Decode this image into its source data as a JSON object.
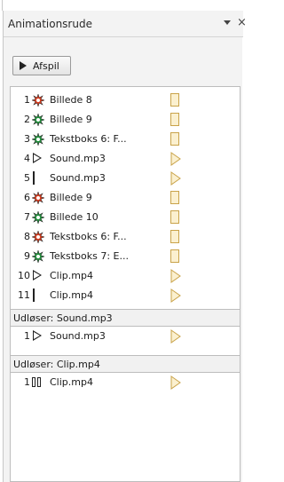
{
  "pane": {
    "title": "Animationsrude",
    "menu_icon": "chevron-down-icon",
    "close_label": "×"
  },
  "toolbar": {
    "play_label": "Afspil"
  },
  "items": [
    {
      "num": "1",
      "icon": "star-burst-red-icon",
      "color": "#e53c1c",
      "name": "Billede 8",
      "timing": "bar"
    },
    {
      "num": "2",
      "icon": "star-burst-green-icon",
      "color": "#1e9a3c",
      "name": "Billede 9",
      "timing": "bar"
    },
    {
      "num": "3",
      "icon": "star-burst-green-icon",
      "color": "#1e9a3c",
      "name": "Tekstboks 6: F...",
      "timing": "bar"
    },
    {
      "num": "4",
      "icon": "play-icon",
      "color": "#222222",
      "name": "Sound.mp3",
      "timing": "triangle"
    },
    {
      "num": "5",
      "icon": "stop-icon",
      "color": "#222222",
      "name": "Sound.mp3",
      "timing": "triangle"
    },
    {
      "num": "6",
      "icon": "star-burst-red-icon",
      "color": "#e53c1c",
      "name": "Billede 9",
      "timing": "bar"
    },
    {
      "num": "7",
      "icon": "star-burst-green-icon",
      "color": "#1e9a3c",
      "name": "Billede 10",
      "timing": "bar"
    },
    {
      "num": "8",
      "icon": "star-burst-red-icon",
      "color": "#e53c1c",
      "name": "Tekstboks 6: F...",
      "timing": "bar"
    },
    {
      "num": "9",
      "icon": "star-burst-green-icon",
      "color": "#1e9a3c",
      "name": "Tekstboks 7: E...",
      "timing": "bar"
    },
    {
      "num": "10",
      "icon": "play-icon",
      "color": "#222222",
      "name": "Clip.mp4",
      "timing": "triangle"
    },
    {
      "num": "11",
      "icon": "stop-icon",
      "color": "#222222",
      "name": "Clip.mp4",
      "timing": "triangle"
    }
  ],
  "triggers": [
    {
      "label": "Udløser: Sound.mp3",
      "items": [
        {
          "num": "1",
          "icon": "play-icon",
          "color": "#222222",
          "name": "Sound.mp3",
          "timing": "triangle"
        }
      ]
    },
    {
      "label": "Udløser: Clip.mp4",
      "items": [
        {
          "num": "1",
          "icon": "pause-icon",
          "color": "#222222",
          "name": "Clip.mp4",
          "timing": "triangle"
        }
      ]
    }
  ],
  "colors": {
    "timing_border": "#c9a34a",
    "timing_fill": "#fbf0cf"
  }
}
